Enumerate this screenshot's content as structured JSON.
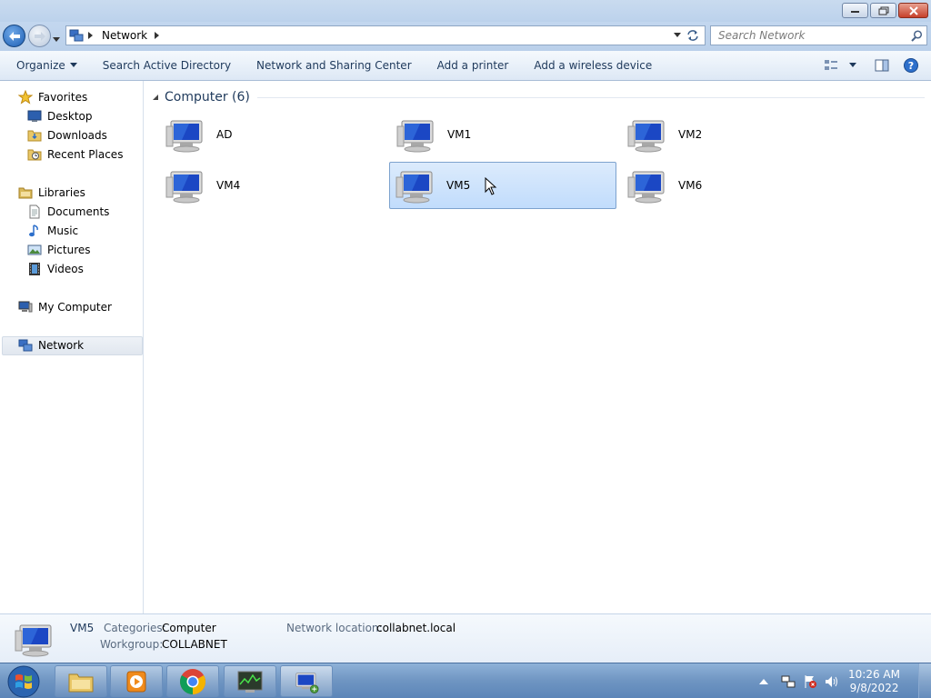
{
  "window": {
    "title": ""
  },
  "address": {
    "crumb": "Network",
    "search_placeholder": "Search Network"
  },
  "toolbar": {
    "organize": "Organize",
    "search_ad": "Search Active Directory",
    "network_center": "Network and Sharing Center",
    "add_printer": "Add a printer",
    "add_wireless": "Add a wireless device"
  },
  "sidebar": {
    "favorites": "Favorites",
    "desktop": "Desktop",
    "downloads": "Downloads",
    "recent": "Recent Places",
    "libraries": "Libraries",
    "documents": "Documents",
    "music": "Music",
    "pictures": "Pictures",
    "videos": "Videos",
    "mycomputer": "My Computer",
    "network": "Network"
  },
  "group": {
    "label": "Computer (6)"
  },
  "computers": [
    "AD",
    "VM1",
    "VM2",
    "VM4",
    "VM5",
    "VM6"
  ],
  "selected": "VM5",
  "details": {
    "name": "VM5",
    "categories_label": "Categories:",
    "categories_value": "Computer",
    "workgroup_label": "Workgroup:",
    "workgroup_value": "COLLABNET",
    "netloc_label": "Network location:",
    "netloc_value": "collabnet.local"
  },
  "clock": {
    "time": "10:26 AM",
    "date": "9/8/2022"
  },
  "colors": {
    "selection": "#c1dcfc",
    "accent": "#1e395b"
  }
}
